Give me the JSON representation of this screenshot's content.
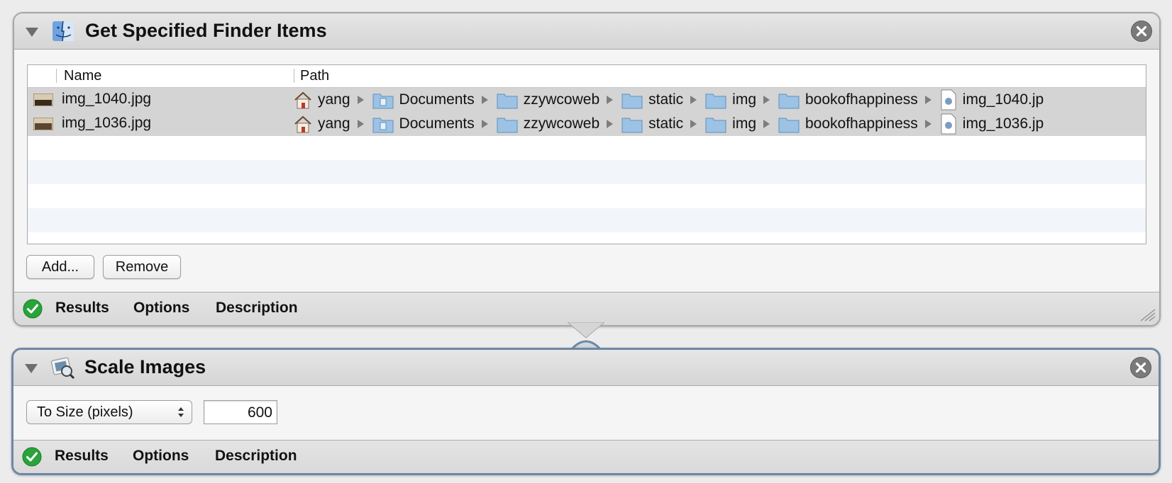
{
  "action1": {
    "title": "Get Specified Finder Items",
    "columns": {
      "name": "Name",
      "path": "Path"
    },
    "rows": [
      {
        "name": "img_1040.jpg",
        "path": [
          "yang",
          "Documents",
          "zzywcoweb",
          "static",
          "img",
          "bookofhappiness",
          "img_1040.jp"
        ]
      },
      {
        "name": "img_1036.jpg",
        "path": [
          "yang",
          "Documents",
          "zzywcoweb",
          "static",
          "img",
          "bookofhappiness",
          "img_1036.jp"
        ]
      }
    ],
    "add_label": "Add...",
    "remove_label": "Remove",
    "footer": {
      "results": "Results",
      "options": "Options",
      "description": "Description"
    }
  },
  "action2": {
    "title": "Scale Images",
    "mode_select": "To Size (pixels)",
    "size_value": "600",
    "footer": {
      "results": "Results",
      "options": "Options",
      "description": "Description"
    }
  },
  "icons": {
    "finder": "finder-icon",
    "preview": "preview-icon",
    "home": "home-icon",
    "folder": "folder-icon",
    "documents_folder": "documents-folder-icon",
    "image_file": "image-file-icon",
    "close": "close-icon",
    "check": "checkmark-icon"
  },
  "colors": {
    "selected_border": "#6f87a4",
    "check_green": "#2aa33a",
    "folder_blue": "#9cc3e6",
    "row_selected": "#d4d4d4"
  }
}
